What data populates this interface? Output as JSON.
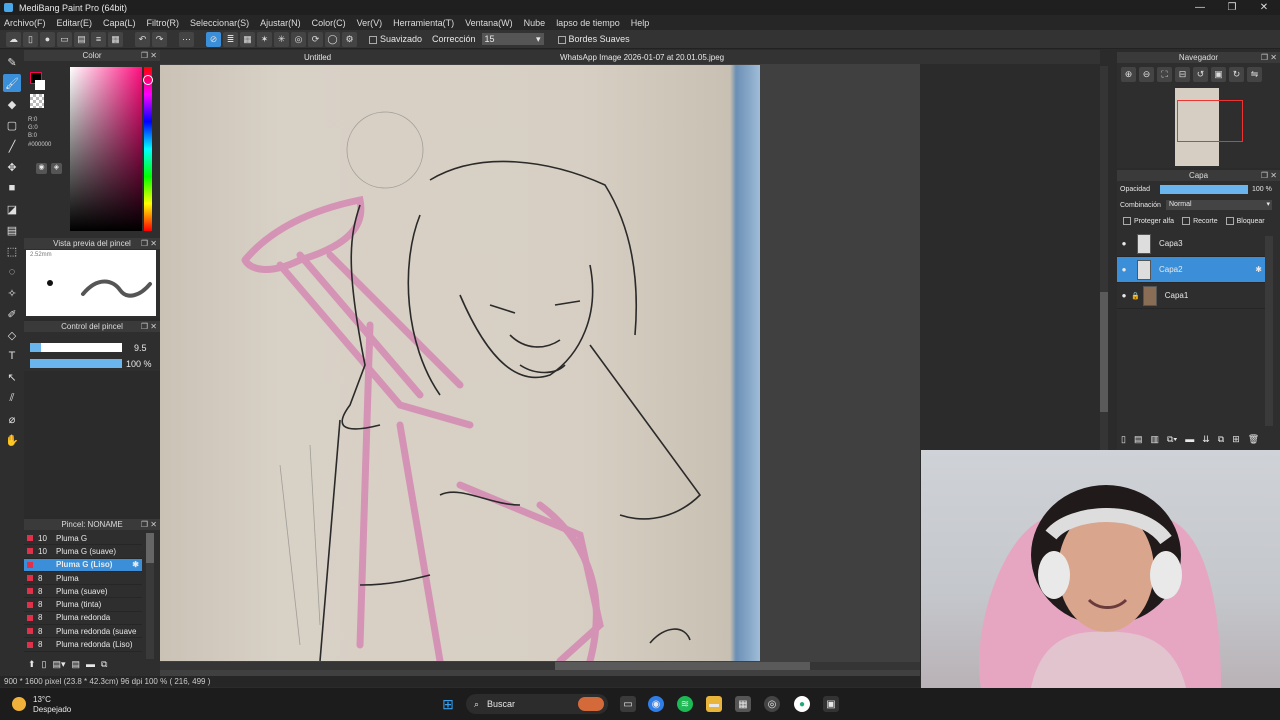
{
  "window": {
    "title": "MediBang Paint Pro (64bit)",
    "controls": [
      "—",
      "❐",
      "✕"
    ]
  },
  "menu": [
    "Archivo(F)",
    "Editar(E)",
    "Capa(L)",
    "Filtro(R)",
    "Seleccionar(S)",
    "Ajustar(N)",
    "Color(C)",
    "Ver(V)",
    "Herramienta(T)",
    "Ventana(W)",
    "Nube",
    "lapso de tiempo",
    "Help"
  ],
  "toolbar": {
    "smooth_label": "Suavizado",
    "correction_label": "Corrección",
    "correction_value": "15",
    "soft_edges_label": "Bordes Suaves"
  },
  "tabs": {
    "active": "Untitled",
    "file": "WhatsApp Image 2026-01-07 at 20.01.05.jpeg"
  },
  "color_panel": {
    "title": "Color",
    "r": "R:0",
    "g": "G:0",
    "b": "B:0",
    "hex": "#000000",
    "accent": "#ff0055"
  },
  "brush_preview": {
    "title": "Vista previa del pincel",
    "size": "2.52mm"
  },
  "brush_control": {
    "title": "Control del pincel",
    "size_value": "9.5",
    "opacity_value": "100 %",
    "size_fraction": 0.12,
    "opacity_fraction": 1.0
  },
  "brush_list": {
    "title": "Pincel: NONAME",
    "items": [
      {
        "size": "10",
        "name": "Pluma G"
      },
      {
        "size": "10",
        "name": "Pluma G (suave)"
      },
      {
        "size": "",
        "name": "Pluma G (Liso)"
      },
      {
        "size": "8",
        "name": "Pluma"
      },
      {
        "size": "8",
        "name": "Pluma (suave)"
      },
      {
        "size": "8",
        "name": "Pluma (tinta)"
      },
      {
        "size": "8",
        "name": "Pluma redonda"
      },
      {
        "size": "8",
        "name": "Pluma redonda (suave"
      },
      {
        "size": "8",
        "name": "Pluma redonda (Liso)"
      }
    ],
    "selected_index": 2
  },
  "navigator": {
    "title": "Navegador"
  },
  "layer_panel": {
    "title": "Capa",
    "opacity_label": "Opacidad",
    "opacity_value": "100 %",
    "blend_label": "Combinación",
    "blend_value": "Normal",
    "protect_alpha": "Proteger alfa",
    "clip": "Recorte",
    "lock": "Bloquear",
    "layers": [
      "Capa3",
      "Capa2",
      "Capa1"
    ],
    "selected_index": 1
  },
  "status": {
    "text": "900 * 1600 pixel  (23.8 * 42.3cm)  96 dpi  100 %  ( 216, 499 )"
  },
  "taskbar": {
    "weather_temp": "13°C",
    "weather_desc": "Despejado",
    "search_placeholder": "Buscar"
  }
}
